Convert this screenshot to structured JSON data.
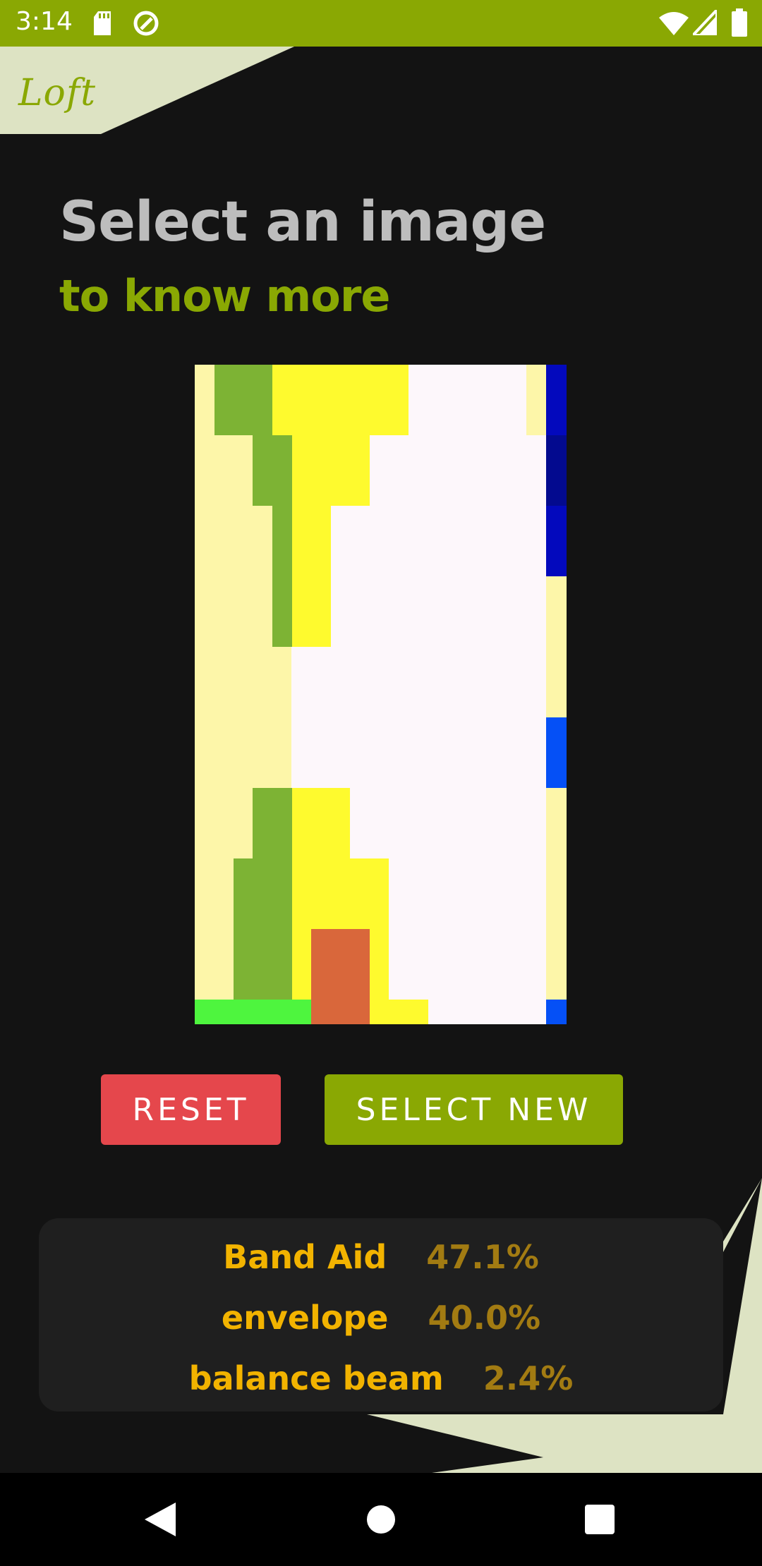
{
  "status_bar": {
    "time": "3:14",
    "left_icons": [
      "sd-card-icon",
      "data-saver-icon"
    ],
    "right_icons": [
      "wifi-icon",
      "signal-icon",
      "battery-icon"
    ],
    "background": "#8aa803"
  },
  "header": {
    "logo_text": "Loft"
  },
  "main": {
    "title": "Select an image",
    "subtitle": "to know more"
  },
  "buttons": {
    "reset_label": "RESET",
    "select_new_label": "SELECT NEW"
  },
  "results": [
    {
      "label": "Band Aid",
      "score": "47.1%"
    },
    {
      "label": "envelope",
      "score": "40.0%"
    },
    {
      "label": "balance beam",
      "score": "2.4%"
    }
  ],
  "colors": {
    "accent": "#8aa803",
    "reset": "#e5474c",
    "result_label": "#f2b300",
    "result_score": "#a27b12",
    "background": "#131313",
    "deco": "#dde3c3"
  },
  "navigation": {
    "buttons": [
      "back-icon",
      "home-icon",
      "recents-icon"
    ]
  }
}
